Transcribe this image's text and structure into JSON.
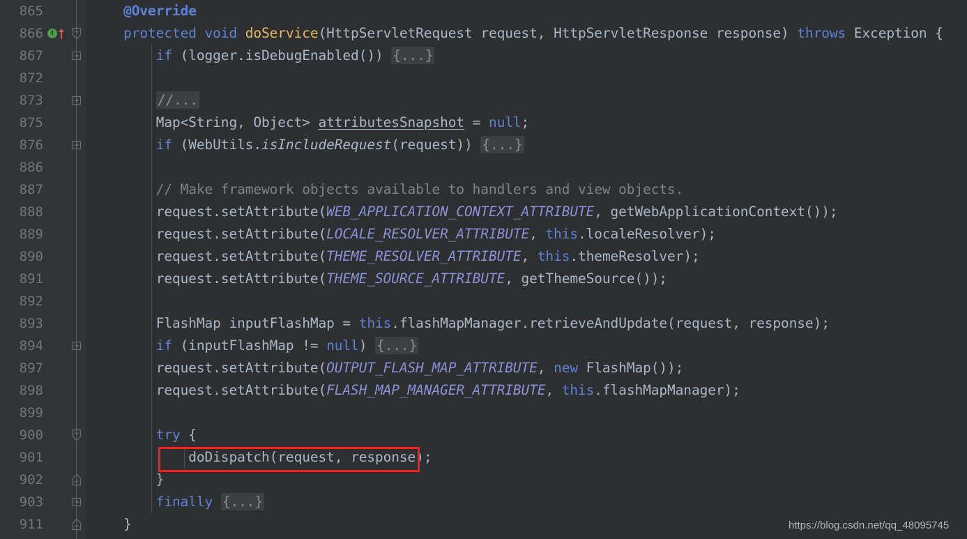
{
  "editor": {
    "theme": "darcula",
    "background": "#2d2f31",
    "gutter_background": "#313335",
    "line_number_color": "#707679",
    "default_text_color": "#a9b7c6",
    "keyword_color": "#5c83d6",
    "method_color": "#e3b768",
    "comment_color": "#7e8486",
    "constant_color": "#8a91d6",
    "fold_placeholder_bg": "#3d4042",
    "annotation_box_color": "#fd1d1d"
  },
  "gutter": {
    "rows": [
      {
        "line": "865",
        "marks": [],
        "fold": "none"
      },
      {
        "line": "866",
        "marks": [
          "override-indicator",
          "up-arrow"
        ],
        "fold": "fold-start-open"
      },
      {
        "line": "867",
        "marks": [],
        "fold": "fold-collapsed"
      },
      {
        "line": "872",
        "marks": [],
        "fold": "none"
      },
      {
        "line": "873",
        "marks": [],
        "fold": "fold-collapsed"
      },
      {
        "line": "875",
        "marks": [],
        "fold": "none"
      },
      {
        "line": "876",
        "marks": [],
        "fold": "fold-collapsed"
      },
      {
        "line": "886",
        "marks": [],
        "fold": "none"
      },
      {
        "line": "887",
        "marks": [],
        "fold": "none"
      },
      {
        "line": "888",
        "marks": [],
        "fold": "none"
      },
      {
        "line": "889",
        "marks": [],
        "fold": "none"
      },
      {
        "line": "890",
        "marks": [],
        "fold": "none"
      },
      {
        "line": "891",
        "marks": [],
        "fold": "none"
      },
      {
        "line": "892",
        "marks": [],
        "fold": "none"
      },
      {
        "line": "893",
        "marks": [],
        "fold": "none"
      },
      {
        "line": "894",
        "marks": [],
        "fold": "fold-collapsed"
      },
      {
        "line": "897",
        "marks": [],
        "fold": "none"
      },
      {
        "line": "898",
        "marks": [],
        "fold": "none"
      },
      {
        "line": "899",
        "marks": [],
        "fold": "none"
      },
      {
        "line": "900",
        "marks": [],
        "fold": "fold-start-open"
      },
      {
        "line": "901",
        "marks": [],
        "fold": "none"
      },
      {
        "line": "902",
        "marks": [],
        "fold": "fold-end"
      },
      {
        "line": "903",
        "marks": [],
        "fold": "fold-collapsed"
      },
      {
        "line": "911",
        "marks": [],
        "fold": "fold-end"
      }
    ]
  },
  "code": {
    "language": "java",
    "lines": [
      {
        "line": "865",
        "text": "        @Override"
      },
      {
        "line": "866",
        "text": "        protected void doService(HttpServletRequest request, HttpServletResponse response) throws Exception {"
      },
      {
        "line": "867",
        "text": "            if (logger.isDebugEnabled()) {...}"
      },
      {
        "line": "872",
        "text": ""
      },
      {
        "line": "873",
        "text": "            //..."
      },
      {
        "line": "875",
        "text": "            Map<String, Object> attributesSnapshot = null;"
      },
      {
        "line": "876",
        "text": "            if (WebUtils.isIncludeRequest(request)) {...}"
      },
      {
        "line": "886",
        "text": ""
      },
      {
        "line": "887",
        "text": "            // Make framework objects available to handlers and view objects."
      },
      {
        "line": "888",
        "text": "            request.setAttribute(WEB_APPLICATION_CONTEXT_ATTRIBUTE, getWebApplicationContext());"
      },
      {
        "line": "889",
        "text": "            request.setAttribute(LOCALE_RESOLVER_ATTRIBUTE, this.localeResolver);"
      },
      {
        "line": "890",
        "text": "            request.setAttribute(THEME_RESOLVER_ATTRIBUTE, this.themeResolver);"
      },
      {
        "line": "891",
        "text": "            request.setAttribute(THEME_SOURCE_ATTRIBUTE, getThemeSource());"
      },
      {
        "line": "892",
        "text": ""
      },
      {
        "line": "893",
        "text": "            FlashMap inputFlashMap = this.flashMapManager.retrieveAndUpdate(request, response);"
      },
      {
        "line": "894",
        "text": "            if (inputFlashMap != null) {...}"
      },
      {
        "line": "897",
        "text": "            request.setAttribute(OUTPUT_FLASH_MAP_ATTRIBUTE, new FlashMap());"
      },
      {
        "line": "898",
        "text": "            request.setAttribute(FLASH_MAP_MANAGER_ATTRIBUTE, this.flashMapManager);"
      },
      {
        "line": "899",
        "text": ""
      },
      {
        "line": "900",
        "text": "            try {"
      },
      {
        "line": "901",
        "text": "                doDispatch(request, response);"
      },
      {
        "line": "902",
        "text": "            }"
      },
      {
        "line": "903",
        "text": "            finally {...}"
      },
      {
        "line": "911",
        "text": "        }"
      }
    ]
  },
  "annotation": {
    "type": "red-rectangle",
    "targets_line": "901",
    "target_text": "doDispatch(request, response);"
  },
  "watermark": {
    "text": "https://blog.csdn.net/qq_48095745"
  }
}
